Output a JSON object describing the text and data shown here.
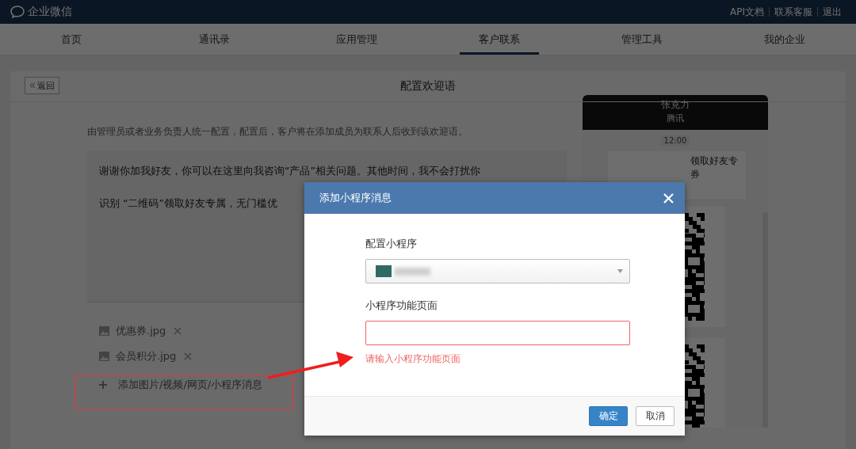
{
  "top_bar": {
    "logo": "企业微信",
    "links": [
      "API文档",
      "联系客服",
      "退出"
    ]
  },
  "nav": {
    "tabs": [
      {
        "label": "首页",
        "selected": false
      },
      {
        "label": "通讯录",
        "selected": false
      },
      {
        "label": "应用管理",
        "selected": false
      },
      {
        "label": "客户联系",
        "selected": true
      },
      {
        "label": "管理工具",
        "selected": false
      },
      {
        "label": "我的企业",
        "selected": false
      }
    ]
  },
  "page": {
    "back": "返回",
    "title": "配置欢迎语",
    "description": "由管理员或者业务负责人统一配置，配置后，客户将在添加成员为联系人后收到该欢迎语。",
    "message": [
      "谢谢你加我好友，你可以在这里向我咨询“产品”相关问题。其他时间，我不会打扰你",
      "识别 “二维码”领取好友专属，无门槛优"
    ],
    "attachments": [
      {
        "name": "优惠券.jpg"
      },
      {
        "name": "会员积分.jpg"
      }
    ],
    "add_button": "添加图片/视频/网页/小程序消息"
  },
  "preview": {
    "name": "张克力",
    "company": "腾讯",
    "time": "12:00",
    "bubble_lines": [
      "领取好友专",
      "券"
    ]
  },
  "modal": {
    "title": "添加小程序消息",
    "fields": [
      {
        "kind": "select",
        "label": "配置小程序"
      },
      {
        "kind": "text",
        "label": "小程序功能页面",
        "error": "请输入小程序功能页面"
      }
    ],
    "buttons": [
      {
        "label": "确定",
        "kind": "primary"
      },
      {
        "label": "取消",
        "kind": "default"
      }
    ]
  }
}
